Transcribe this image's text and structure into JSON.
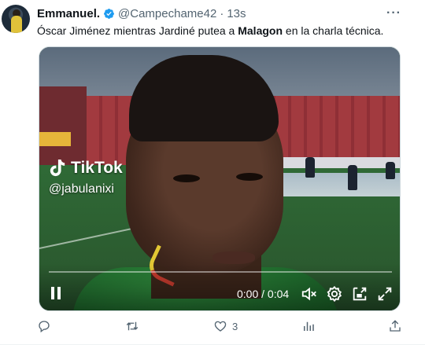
{
  "tweet": {
    "author_name": "Emmanuel.",
    "handle": "@Campechame42",
    "separator": "·",
    "time": "13s",
    "more_label": "···",
    "text_before": "Óscar Jiménez mientras Jardiné putea a ",
    "text_bold": "Malagon",
    "text_after": " en la charla técnica."
  },
  "video": {
    "watermark_brand": "TikTok",
    "watermark_user": "@jabulanixi",
    "time_display": "0:00 / 0:04",
    "progress": 0
  },
  "actions": {
    "reply_count": "",
    "retweet_count": "",
    "like_count": "3",
    "views_count": ""
  },
  "colors": {
    "verified_blue": "#1d9bf0",
    "secondary_text": "#536471",
    "primary_text": "#0f1419"
  },
  "icons": [
    "verified-badge-icon",
    "reply-icon",
    "retweet-icon",
    "like-icon",
    "views-icon",
    "share-icon",
    "pause-icon",
    "mute-icon",
    "settings-icon",
    "pip-icon",
    "fullscreen-icon",
    "tiktok-logo-icon"
  ]
}
